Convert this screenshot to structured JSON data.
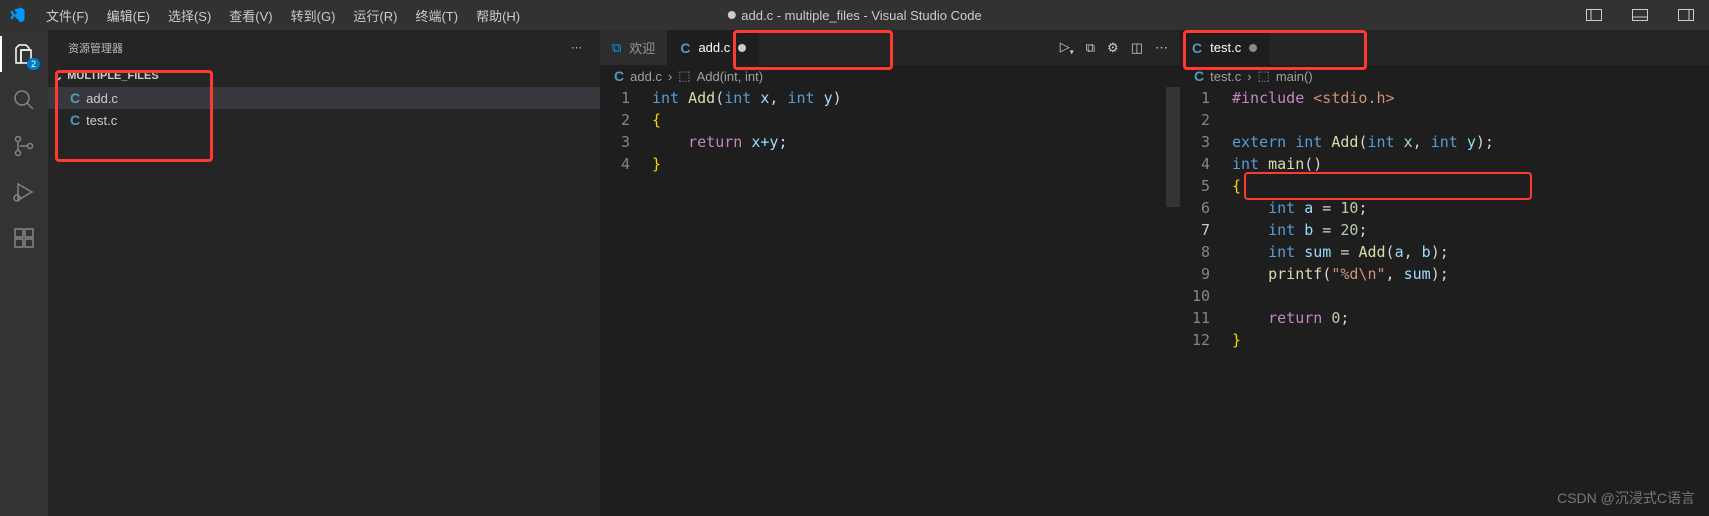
{
  "menu": [
    "文件(F)",
    "编辑(E)",
    "选择(S)",
    "查看(V)",
    "转到(G)",
    "运行(R)",
    "终端(T)",
    "帮助(H)"
  ],
  "window_title": "add.c - multiple_files - Visual Studio Code",
  "sidebar": {
    "title": "资源管理器",
    "folder": "MULTIPLE_FILES",
    "files": [
      "add.c",
      "test.c"
    ]
  },
  "activity_badge": "2",
  "editor1": {
    "tabs": [
      {
        "label": "欢迎",
        "kind": "welcome"
      },
      {
        "label": "add.c",
        "kind": "c",
        "dirty": true,
        "active": true
      }
    ],
    "breadcrumb": {
      "file": "add.c",
      "symbol": "Add(int, int)"
    },
    "lines": [
      "1",
      "2",
      "3",
      "4"
    ]
  },
  "editor2": {
    "tabs": [
      {
        "label": "test.c",
        "kind": "c",
        "dirty": true,
        "active": true
      }
    ],
    "breadcrumb": {
      "file": "test.c",
      "symbol": "main()"
    },
    "lines": [
      "1",
      "2",
      "3",
      "4",
      "5",
      "6",
      "7",
      "8",
      "9",
      "10",
      "11",
      "12"
    ]
  },
  "code1": {
    "l1_kw": "int ",
    "l1_fn": "Add",
    "l1_open": "(",
    "l1_t1": "int ",
    "l1_p1": "x",
    "l1_comma": ", ",
    "l1_t2": "int ",
    "l1_p2": "y",
    "l1_close": ")",
    "l2": "{",
    "l3_kw": "return ",
    "l3_expr": "x+y",
    "l3_semi": ";",
    "l4": "}"
  },
  "code2": {
    "l1_inc": "#include ",
    "l1_hdr": "<stdio.h>",
    "l3_ext": "extern ",
    "l3_int": "int ",
    "l3_fn": "Add",
    "l3_open": "(",
    "l3_t1": "int ",
    "l3_p1": "x",
    "l3_c": ", ",
    "l3_t2": "int ",
    "l3_p2": "y",
    "l3_close": ");",
    "l4_int": "int ",
    "l4_fn": "main",
    "l4_paren": "()",
    "l5": "{",
    "l6_int": "int ",
    "l6_v": "a",
    "l6_eq": " = ",
    "l6_n": "10",
    "l6_s": ";",
    "l7_int": "int ",
    "l7_v": "b",
    "l7_eq": " = ",
    "l7_n": "20",
    "l7_s": ";",
    "l8_int": "int ",
    "l8_v": "sum",
    "l8_eq": " = ",
    "l8_fn": "Add",
    "l8_open": "(",
    "l8_a": "a",
    "l8_c": ", ",
    "l8_b": "b",
    "l8_close": ");",
    "l9_fn": "printf",
    "l9_open": "(",
    "l9_str": "\"%d\\n\"",
    "l9_c": ", ",
    "l9_v": "sum",
    "l9_close": ");",
    "l11_kw": "return ",
    "l11_n": "0",
    "l11_s": ";",
    "l12": "}"
  },
  "watermark": "CSDN @沉浸式C语言"
}
